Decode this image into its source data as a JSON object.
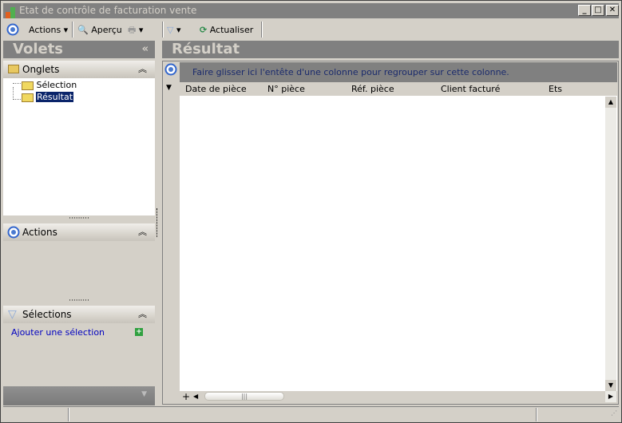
{
  "window": {
    "title": "Etat de contrôle de facturation vente",
    "min": "_",
    "max": "□",
    "close": "✕"
  },
  "toolbar": {
    "actions": "Actions",
    "apercu": "Aperçu",
    "actualiser": "Actualiser"
  },
  "left": {
    "title": "Volets",
    "collapse": "«",
    "onglets": {
      "title": "Onglets",
      "items": [
        "Sélection",
        "Résultat"
      ]
    },
    "actions": {
      "title": "Actions"
    },
    "selections": {
      "title": "Sélections",
      "add_link": "Ajouter une sélection"
    }
  },
  "main": {
    "title": "Résultat",
    "group_hint": "Faire glisser ici l'entête d'une colonne pour regrouper sur cette colonne.",
    "columns": [
      "Date de pièce",
      "N° pièce",
      "Réf. pièce",
      "Client facturé",
      "Ets"
    ]
  },
  "colors": {
    "header": "#808080",
    "link": "#0000c0",
    "hint": "#1a2a6c"
  }
}
